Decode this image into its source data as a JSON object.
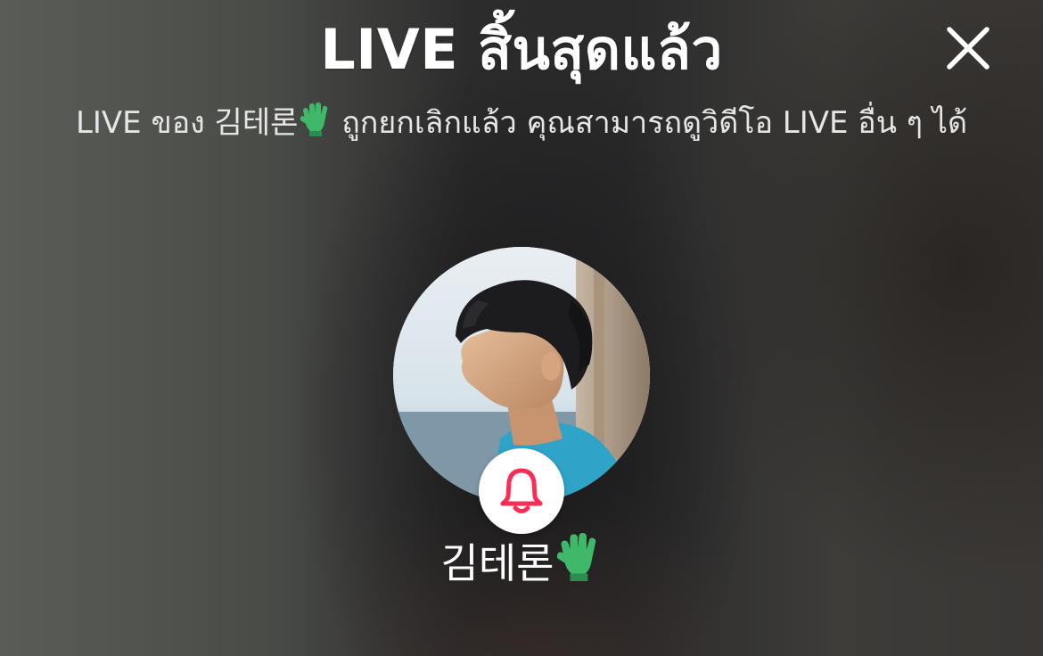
{
  "ended_screen": {
    "title": "LIVE สิ้นสุดแล้ว",
    "subtitle_before_emoji": "LIVE ของ 김테론",
    "subtitle_after_emoji": " ถูกยกเลิกแล้ว คุณสามารถดูวิดีโอ LIVE อื่น ๆ ได้",
    "close_icon": "close-icon",
    "host": {
      "name": "김테론",
      "name_emoji": "green-glove-emoji",
      "avatar": "profile-photo",
      "notify_icon": "bell-icon",
      "notify_color": "#fe2c55"
    }
  }
}
